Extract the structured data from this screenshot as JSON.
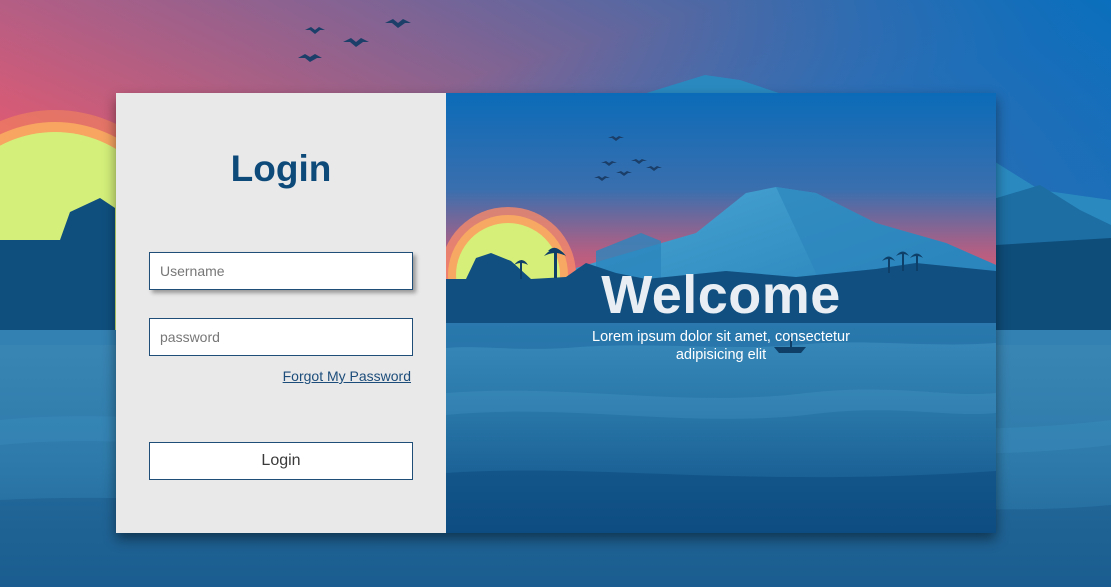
{
  "login": {
    "title": "Login",
    "username_placeholder": "Username",
    "password_placeholder": "password",
    "forgot_link": "Forgot My Password",
    "submit_label": "Login"
  },
  "hero": {
    "title": "Welcome",
    "subtitle": "Lorem ipsum dolor sit amet, consectetur adipisicing elit"
  },
  "colors": {
    "accent": "#0d4a7a",
    "panel_bg": "#e9e9ea",
    "sky_top": "#1b6bb3",
    "sky_glow": "#f0556b",
    "sun": "#d7f07a",
    "water": "#2b7fb0"
  }
}
